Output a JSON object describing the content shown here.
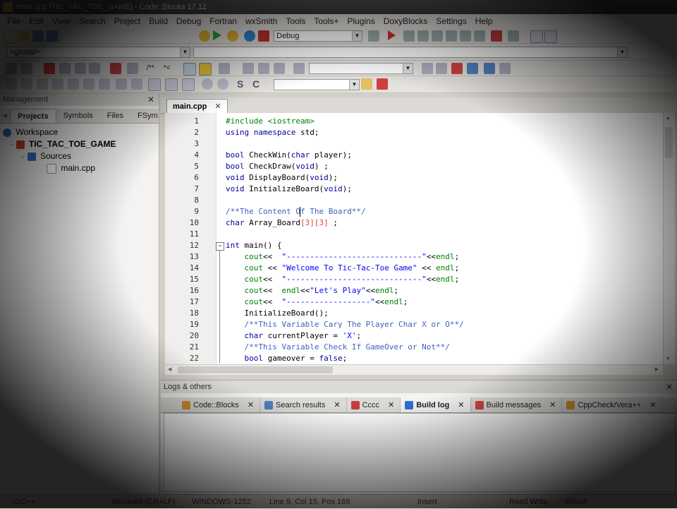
{
  "window": {
    "title": "main.cpp [TIC_TAC_TOE_GAME] - Code::Blocks 17.12"
  },
  "menu": [
    "File",
    "Edit",
    "View",
    "Search",
    "Project",
    "Build",
    "Debug",
    "Fortran",
    "wxSmith",
    "Tools",
    "Tools+",
    "Plugins",
    "DoxyBlocks",
    "Settings",
    "Help"
  ],
  "toolbar": {
    "build_target": "Debug",
    "scope": "<global>"
  },
  "management": {
    "title": "Management",
    "tabs": [
      "Projects",
      "Symbols",
      "Files",
      "FSym"
    ],
    "active_tab": "Projects",
    "tree": {
      "workspace": "Workspace",
      "project": "TIC_TAC_TOE_GAME",
      "folder": "Sources",
      "file": "main.cpp"
    }
  },
  "editor": {
    "tab_label": "main.cpp",
    "lines": [
      {
        "n": "1",
        "html": "<span class='pre'>#include &lt;iostream&gt;</span>"
      },
      {
        "n": "2",
        "html": "<span class='kw'>using namespace</span> std;"
      },
      {
        "n": "3",
        "html": ""
      },
      {
        "n": "4",
        "html": "<span class='kw'>bool</span> CheckWin(<span class='kw'>char</span> player);"
      },
      {
        "n": "5",
        "html": "<span class='kw'>bool</span> CheckDraw(<span class='kw'>void</span>) ;"
      },
      {
        "n": "6",
        "html": "<span class='kw'>void</span> DisplayBoard(<span class='kw'>void</span>);"
      },
      {
        "n": "7",
        "html": "<span class='kw'>void</span> InitializeBoard(<span class='kw'>void</span>);"
      },
      {
        "n": "8",
        "html": ""
      },
      {
        "n": "9",
        "html": "<span class='cmt'>/**The Content Of The Board**/</span>"
      },
      {
        "n": "10",
        "html": "<span class='kw'>char</span> Array_Board<span class='num'>[3][3]</span> ;"
      },
      {
        "n": "11",
        "html": ""
      },
      {
        "n": "12",
        "html": "<span class='kw'>int</span> main() {"
      },
      {
        "n": "13",
        "html": "    <span class='cout'>cout</span>&lt;&lt;  <span class='str'>\"-----------------------------\"</span>&lt;&lt;<span class='cout'>endl</span>;"
      },
      {
        "n": "14",
        "html": "    <span class='cout'>cout</span> &lt;&lt; <span class='str'>\"Welcome To Tic-Tac-Toe Game\"</span> &lt;&lt; <span class='cout'>endl</span>;"
      },
      {
        "n": "15",
        "html": "    <span class='cout'>cout</span>&lt;&lt;  <span class='str'>\"-----------------------------\"</span>&lt;&lt;<span class='cout'>endl</span>;"
      },
      {
        "n": "16",
        "html": "    <span class='cout'>cout</span>&lt;&lt;  <span class='cout'>endl</span>&lt;&lt;<span class='str'>\"Let's Play\"</span>&lt;&lt;<span class='cout'>endl</span>;"
      },
      {
        "n": "17",
        "html": "    <span class='cout'>cout</span>&lt;&lt;  <span class='str'>\"------------------\"</span>&lt;&lt;<span class='cout'>endl</span>;"
      },
      {
        "n": "18",
        "html": "    InitializeBoard();"
      },
      {
        "n": "19",
        "html": "    <span class='cmt'>/**This Variable Cary The Player Char X or O**/</span>"
      },
      {
        "n": "20",
        "html": "    <span class='kw'>char</span> currentPlayer = <span class='str'>'X'</span>;"
      },
      {
        "n": "21",
        "html": "    <span class='cmt'>/**This Variable Check If GameOver or Not**/</span>"
      },
      {
        "n": "22",
        "html": "    <span class='kw'>bool</span> gameover = <span class='kw'>false</span>;"
      }
    ]
  },
  "logs": {
    "title": "Logs & others",
    "tabs": [
      {
        "label": "Code::Blocks",
        "color": "#d09030"
      },
      {
        "label": "Search results",
        "color": "#5080c0"
      },
      {
        "label": "Cccc",
        "color": "#c04040"
      },
      {
        "label": "Build log",
        "color": "#3070d0",
        "active": true
      },
      {
        "label": "Build messages",
        "color": "#d04040"
      },
      {
        "label": "CppCheck/Vera++",
        "color": "#d09030"
      }
    ]
  },
  "status": {
    "language": "C/C++",
    "eol": "Windows (CR+LF)",
    "encoding": "WINDOWS-1252",
    "position": "Line 9, Col 15, Pos 169",
    "mode": "Insert",
    "access": "Read Write",
    "profile": "default"
  }
}
